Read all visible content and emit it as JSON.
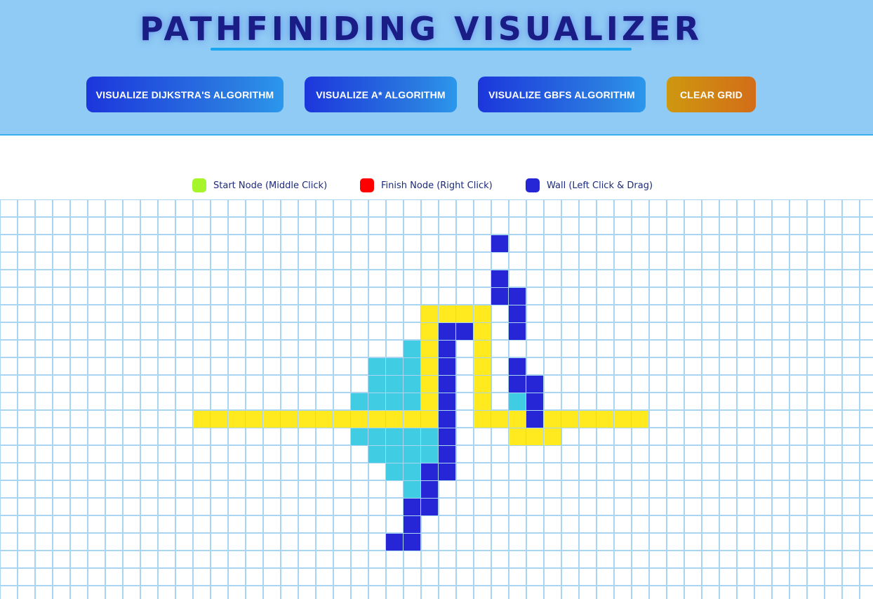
{
  "app": {
    "title": "PATHFINIDING VISUALIZER"
  },
  "toolbar": {
    "buttons": [
      {
        "label": "VISUALIZE DIJKSTRA'S ALGORITHM"
      },
      {
        "label": "VISUALIZE A* ALGORITHM"
      },
      {
        "label": "VISUALIZE GBFS ALGORITHM"
      },
      {
        "label": "CLEAR GRID"
      }
    ]
  },
  "legend": {
    "items": [
      {
        "label": "Start Node (Middle Click)",
        "color": "#a6f52a"
      },
      {
        "label": "Finish Node (Right Click)",
        "color": "#ff0000"
      },
      {
        "label": "Wall (Left Click & Drag)",
        "color": "#2626d6"
      }
    ]
  },
  "colors": {
    "wall": "#2626d6",
    "visited": "#40cde4",
    "path": "#ffea1f",
    "grid_line": "#a9d5f0",
    "header_bg": "#8fcbf4"
  },
  "grid": {
    "walls": [
      [
        28,
        2
      ],
      [
        28,
        4
      ],
      [
        28,
        5
      ],
      [
        29,
        5
      ],
      [
        29,
        6
      ],
      [
        29,
        7
      ],
      [
        25,
        7
      ],
      [
        26,
        7
      ],
      [
        25,
        8
      ],
      [
        25,
        9
      ],
      [
        29,
        9
      ],
      [
        25,
        10
      ],
      [
        29,
        10
      ],
      [
        30,
        10
      ],
      [
        25,
        11
      ],
      [
        30,
        11
      ],
      [
        25,
        12
      ],
      [
        30,
        12
      ],
      [
        25,
        13
      ],
      [
        25,
        14
      ],
      [
        24,
        15
      ],
      [
        25,
        15
      ],
      [
        24,
        16
      ],
      [
        23,
        17
      ],
      [
        24,
        17
      ],
      [
        23,
        18
      ],
      [
        22,
        19
      ],
      [
        23,
        19
      ]
    ],
    "visited": [
      [
        23,
        8
      ],
      [
        21,
        9
      ],
      [
        22,
        9
      ],
      [
        23,
        9
      ],
      [
        21,
        10
      ],
      [
        22,
        10
      ],
      [
        23,
        10
      ],
      [
        20,
        11
      ],
      [
        21,
        11
      ],
      [
        22,
        11
      ],
      [
        23,
        11
      ],
      [
        29,
        11
      ],
      [
        20,
        13
      ],
      [
        21,
        13
      ],
      [
        22,
        13
      ],
      [
        23,
        13
      ],
      [
        24,
        13
      ],
      [
        21,
        14
      ],
      [
        22,
        14
      ],
      [
        23,
        14
      ],
      [
        24,
        14
      ],
      [
        22,
        15
      ],
      [
        23,
        15
      ],
      [
        23,
        16
      ]
    ],
    "path": [
      [
        24,
        6
      ],
      [
        25,
        6
      ],
      [
        26,
        6
      ],
      [
        27,
        6
      ],
      [
        24,
        7
      ],
      [
        27,
        7
      ],
      [
        24,
        8
      ],
      [
        27,
        8
      ],
      [
        24,
        9
      ],
      [
        27,
        9
      ],
      [
        24,
        10
      ],
      [
        27,
        10
      ],
      [
        24,
        11
      ],
      [
        27,
        11
      ],
      [
        11,
        12
      ],
      [
        12,
        12
      ],
      [
        13,
        12
      ],
      [
        14,
        12
      ],
      [
        15,
        12
      ],
      [
        16,
        12
      ],
      [
        17,
        12
      ],
      [
        18,
        12
      ],
      [
        19,
        12
      ],
      [
        20,
        12
      ],
      [
        21,
        12
      ],
      [
        22,
        12
      ],
      [
        23,
        12
      ],
      [
        24,
        12
      ],
      [
        27,
        12
      ],
      [
        28,
        12
      ],
      [
        29,
        12
      ],
      [
        31,
        12
      ],
      [
        32,
        12
      ],
      [
        33,
        12
      ],
      [
        34,
        12
      ],
      [
        35,
        12
      ],
      [
        36,
        12
      ],
      [
        29,
        13
      ],
      [
        30,
        13
      ],
      [
        31,
        13
      ]
    ]
  }
}
